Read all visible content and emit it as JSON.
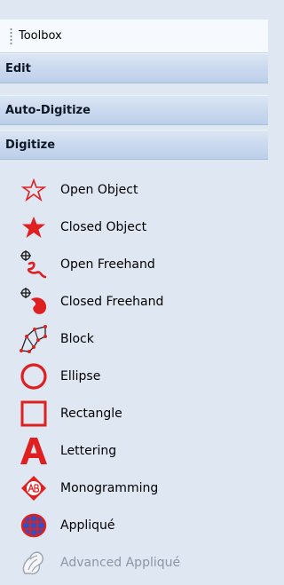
{
  "toolbox": {
    "title": "Toolbox"
  },
  "sections": {
    "edit": "Edit",
    "auto_digitize": "Auto-Digitize",
    "digitize": "Digitize"
  },
  "tools": [
    {
      "label": "Open Object",
      "icon": "open-star-icon"
    },
    {
      "label": "Closed Object",
      "icon": "filled-star-icon"
    },
    {
      "label": "Open Freehand",
      "icon": "open-freehand-icon"
    },
    {
      "label": "Closed Freehand",
      "icon": "closed-freehand-icon"
    },
    {
      "label": "Block",
      "icon": "block-icon"
    },
    {
      "label": "Ellipse",
      "icon": "ellipse-icon"
    },
    {
      "label": "Rectangle",
      "icon": "rectangle-icon"
    },
    {
      "label": "Lettering",
      "icon": "lettering-icon"
    },
    {
      "label": "Monogramming",
      "icon": "monogram-icon"
    },
    {
      "label": "Appliqué",
      "icon": "applique-icon"
    },
    {
      "label": "Advanced Appliqué",
      "icon": "advanced-applique-icon",
      "disabled": true
    }
  ],
  "colors": {
    "accent_red": "#e02020",
    "applique_blue": "#2a52c9"
  }
}
